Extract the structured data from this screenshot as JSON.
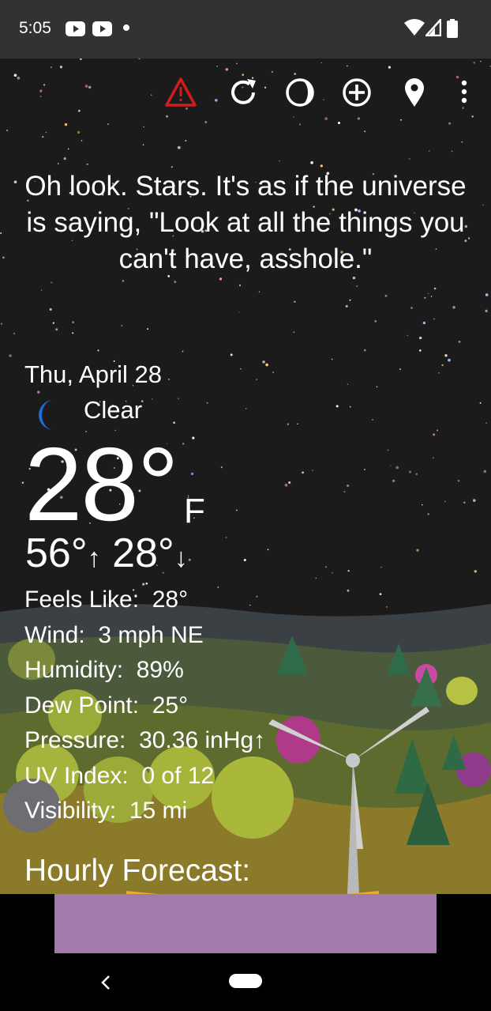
{
  "status_bar": {
    "time": "5:05"
  },
  "toolbar": {
    "icons": [
      "warning-icon",
      "refresh-icon",
      "moon-phase-icon",
      "add-location-icon",
      "location-pin-icon",
      "more-options-icon"
    ],
    "warning_color": "#d01c1c"
  },
  "quote": "Oh look. Stars. It's as if the universe is saying, \"Look at all the things you can't have, asshole.\"",
  "weather": {
    "date": "Thu, April 28",
    "condition": "Clear",
    "condition_icon": "crescent-moon-icon",
    "temperature": "28°",
    "unit": "F",
    "high": "56°",
    "low": "28°",
    "details": [
      {
        "label": "Feels Like:",
        "value": "28°"
      },
      {
        "label": "Wind:",
        "value": "3 mph NE"
      },
      {
        "label": "Humidity:",
        "value": "89%"
      },
      {
        "label": "Dew Point:",
        "value": "25°"
      },
      {
        "label": "Pressure:",
        "value": "30.36 inHg↑"
      },
      {
        "label": "UV Index:",
        "value": "0 of 12"
      },
      {
        "label": "Visibility:",
        "value": "15 mi"
      }
    ],
    "hourly_title": "Hourly Forecast:"
  },
  "colors": {
    "moon": "#1a6fd6",
    "hourly_strip": "#a37aac",
    "sky": "#1b1b1c"
  }
}
